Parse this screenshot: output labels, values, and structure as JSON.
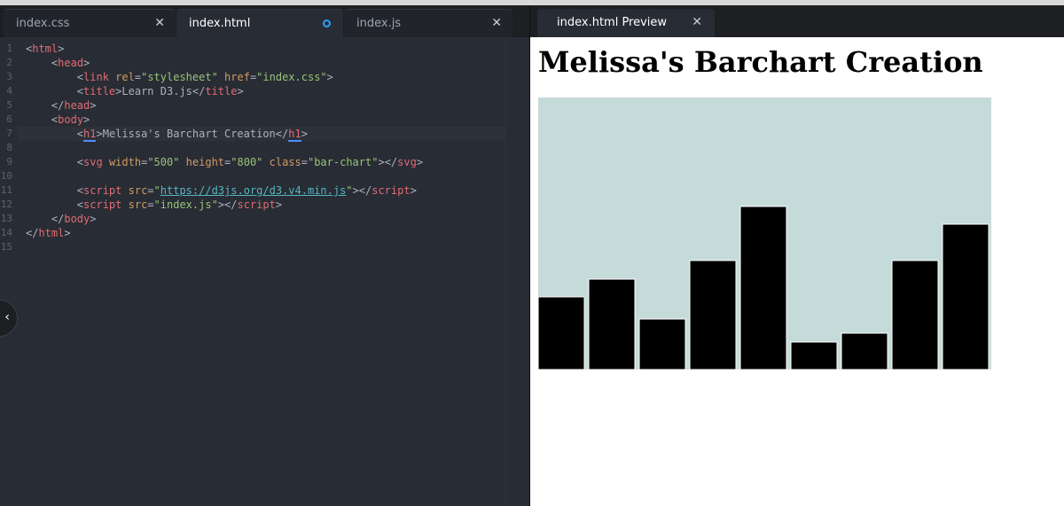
{
  "editor": {
    "tabs": [
      {
        "label": "index.css",
        "state": "close"
      },
      {
        "label": "index.html",
        "state": "modified"
      },
      {
        "label": "index.js",
        "state": "close"
      }
    ],
    "close_glyph": "✕",
    "line_numbers": [
      "1",
      "2",
      "3",
      "4",
      "5",
      "6",
      "7",
      "8",
      "9",
      "10",
      "11",
      "12",
      "13",
      "14",
      "15"
    ],
    "code": {
      "l1": {
        "lt": "<",
        "tag": "html",
        "gt": ">"
      },
      "l2": {
        "lt": "<",
        "tag": "head",
        "gt": ">"
      },
      "l3": {
        "lt": "<",
        "tag": "link",
        "attr1": "rel",
        "eq1": "=",
        "val1": "\"stylesheet\"",
        "attr2": "href",
        "eq2": "=",
        "val2": "\"index.css\"",
        "gt": ">"
      },
      "l4": {
        "lt": "<",
        "tag": "title",
        "gt": ">",
        "text": "Learn D3.js",
        "close_lt": "</",
        "close_tag": "title",
        "close_gt": ">"
      },
      "l5": {
        "lt": "</",
        "tag": "head",
        "gt": ">"
      },
      "l6": {
        "lt": "<",
        "tag": "body",
        "gt": ">"
      },
      "l7": {
        "lt": "<",
        "tag": "h1",
        "gt": ">",
        "text": "Melissa's Barchart Creation",
        "close_lt": "</",
        "close_tag": "h1",
        "close_gt": ">"
      },
      "l9": {
        "lt": "<",
        "tag": "svg",
        "attr1": "width",
        "eq1": "=",
        "val1": "\"500\"",
        "attr2": "height",
        "eq2": "=",
        "val2": "\"800\"",
        "attr3": "class",
        "eq3": "=",
        "val3": "\"bar-chart\"",
        "gt": ">",
        "close_lt": "</",
        "close_tag": "svg",
        "close_gt": ">"
      },
      "l11": {
        "lt": "<",
        "tag": "script",
        "attr1": "src",
        "eq1": "=",
        "q1": "\"",
        "url": "https://d3js.org/d3.v4.min.js",
        "q2": "\"",
        "gt": ">",
        "close_lt": "</",
        "close_tag": "script",
        "close_gt": ">"
      },
      "l12": {
        "lt": "<",
        "tag": "script",
        "attr1": "src",
        "eq1": "=",
        "val1": "\"index.js\"",
        "gt": ">",
        "close_lt": "</",
        "close_tag": "script",
        "close_gt": ">"
      },
      "l13": {
        "lt": "</",
        "tag": "body",
        "gt": ">"
      },
      "l14": {
        "lt": "</",
        "tag": "html",
        "gt": ">"
      }
    },
    "collapse_glyph": "‹"
  },
  "preview": {
    "tab_label": "index.html Preview",
    "close_glyph": "✕",
    "title": "Melissa's Barchart Creation"
  },
  "chart_data": {
    "type": "bar",
    "values": [
      80,
      100,
      56,
      120,
      180,
      30,
      40,
      120,
      160
    ],
    "ylim": [
      0,
      300
    ],
    "background": "#c5dbda",
    "bar_color": "#000000",
    "gap_color": "#ffffff"
  },
  "colors": {
    "editor_bg": "#282c34",
    "tag": "#e06c75",
    "attribute": "#d19a66",
    "string": "#98c379",
    "modified_dot": "#2aa1ff"
  }
}
